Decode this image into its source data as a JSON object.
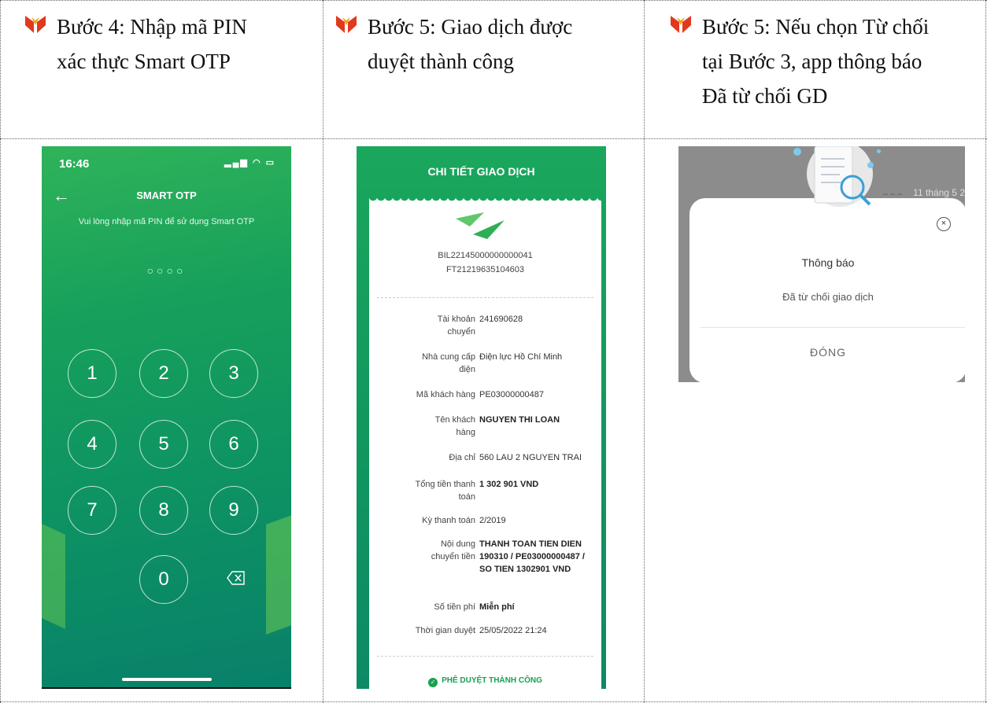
{
  "columns": [
    {
      "line1_left": "Bước 4: Nhập mã PIN",
      "line2": "xác thực Smart OTP"
    },
    {
      "line1_left": "Bước 5: Giao dịch được",
      "line2": "duyệt thành công"
    },
    {
      "line1_left": "Bước 5: Nếu chọn Từ chối",
      "line2": "tại Bước 3, app thông báo",
      "line3": "Đã từ chối GD"
    }
  ],
  "otp_screen": {
    "time": "16:46",
    "status_icons": "signal wifi battery",
    "title": "SMART OTP",
    "message": "Vui lòng nhập mã PIN để sử dụng Smart OTP",
    "pin_dots": "○○○○",
    "keys": [
      "1",
      "2",
      "3",
      "4",
      "5",
      "6",
      "7",
      "8",
      "9",
      "0"
    ],
    "colors": {
      "gradient_top": "#2fb35a",
      "gradient_bottom": "#08806a"
    }
  },
  "receipt_screen": {
    "header": "CHI TIẾT GIAO DỊCH",
    "ref1": "BIL22145000000000041",
    "ref2": "FT21219635104603",
    "rows": [
      {
        "label": "Tài khoản\nchuyển",
        "value": "241690628",
        "bold": false
      },
      {
        "label": "Nhà cung cấp\nđiện",
        "value": "Điện lực Hồ Chí Minh",
        "bold": false
      },
      {
        "label": "Mã khách hàng",
        "value": "PE03000000487",
        "bold": false
      },
      {
        "label": "Tên khách\nhàng",
        "value": "NGUYEN THI LOAN",
        "bold": true
      },
      {
        "label": "Địa chỉ",
        "value": "560 LAU 2 NGUYEN TRAI",
        "bold": false
      },
      {
        "label": "Tổng tiền thanh\ntoán",
        "value": "1 302 901 VND",
        "bold": true
      },
      {
        "label": "Kỳ thanh toán",
        "value": "2/2019",
        "bold": false
      },
      {
        "label": "Nội dung\nchuyển tiền",
        "value": "THANH TOAN TIEN DIEN 190310 / PE03000000487 / SO TIEN 1302901 VND",
        "bold": true
      },
      {
        "label": "Số tiền phí",
        "value": "Miễn phí",
        "bold": true
      },
      {
        "label": "Thời gian duyệt",
        "value": "25/05/2022 21:24",
        "bold": false
      }
    ],
    "status": "PHÊ DUYỆT THÀNH CÔNG",
    "colors": {
      "accent": "#18a14f"
    }
  },
  "reject_screen": {
    "bg_date": "11 tháng 5 2",
    "dialog_title": "Thông báo",
    "dialog_message": "Đã từ chối giao dịch",
    "close_label": "×",
    "button_label": "ĐÓNG"
  }
}
